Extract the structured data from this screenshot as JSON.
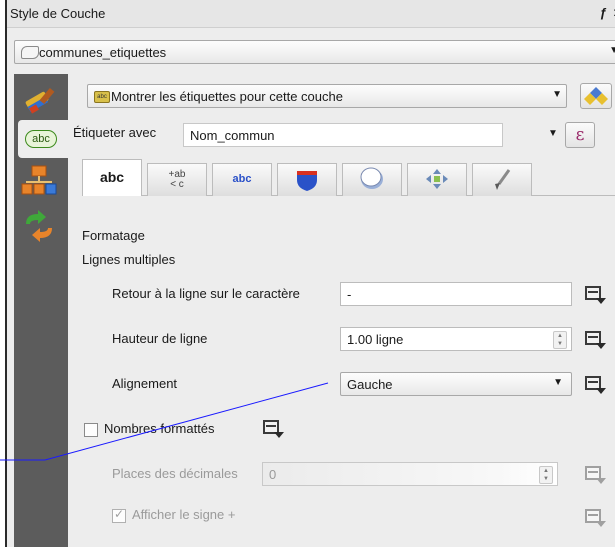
{
  "window": {
    "title": "Style de Couche",
    "float_glyph": "ƒ",
    "close_glyph": ">"
  },
  "layer_select": {
    "value": "communes_etiquettes"
  },
  "labels": {
    "mode_value": "Montrer les étiquettes pour cette couche",
    "label_with_text": "Étiqueter avec",
    "field_value": "Nom_commun",
    "expression_glyph": "ε",
    "small_abc": "abc"
  },
  "sidebar": {
    "items": [
      {
        "name": "style",
        "icon": "paintbrush-icon"
      },
      {
        "name": "labels",
        "icon": "abc-label-icon",
        "label": "abc"
      },
      {
        "name": "fields",
        "icon": "hierarchy-icon"
      },
      {
        "name": "actions",
        "icon": "arrows-icon"
      }
    ]
  },
  "tabs": [
    {
      "label": "abc",
      "icon": "text-tab"
    },
    {
      "label": "+ab\n< c",
      "icon": "formatting-tab"
    },
    {
      "label": "abc",
      "icon": "buffer-tab"
    },
    {
      "label": "",
      "icon": "background-shield-icon"
    },
    {
      "label": "",
      "icon": "shadow-icon"
    },
    {
      "label": "",
      "icon": "placement-icon"
    },
    {
      "label": "",
      "icon": "rendering-brush-icon"
    }
  ],
  "formatting": {
    "section_title": "Formatage",
    "multiline_title": "Lignes multiples",
    "wrap_label": "Retour à la ligne sur le caractère",
    "wrap_value": "-",
    "line_height_label": "Hauteur de ligne",
    "line_height_value": "1.00 ligne",
    "alignment_label": "Alignement",
    "alignment_value": "Gauche",
    "formatted_numbers_label": "Nombres formattés",
    "formatted_numbers_checked": false,
    "decimal_places_label": "Places des décimales",
    "decimal_places_value": "0",
    "show_plus_label": "Afficher le signe +",
    "show_plus_checked": true
  },
  "colors": {
    "sidebar": "#5c5c5c",
    "panel": "#ededed",
    "annotation_line": "#1a1aff"
  }
}
